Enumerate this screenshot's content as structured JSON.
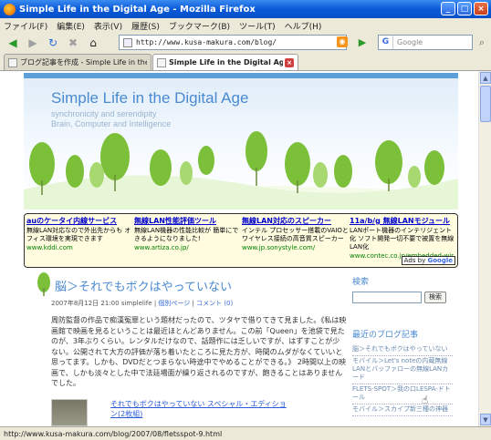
{
  "window": {
    "title": "Simple Life in the Digital Age - Mozilla Firefox"
  },
  "menu": [
    "ファイル(F)",
    "編集(E)",
    "表示(V)",
    "履歴(S)",
    "ブックマーク(B)",
    "ツール(T)",
    "ヘルプ(H)"
  ],
  "nav": {
    "url": "http://www.kusa-makura.com/blog/",
    "search_placeholder": "Google",
    "search_engine": "G"
  },
  "tabs": [
    {
      "label": "ブログ記事を作成 - Simple Life in the..."
    },
    {
      "label": "Simple Life in the Digital Age"
    }
  ],
  "header": {
    "title": "Simple Life in the Digital Age",
    "tagline": "synchronicity and serendipity",
    "sub": "Brain, Computer and Intelligence"
  },
  "ads": [
    {
      "title": "auのケータイ内線サービス",
      "desc": "無線LAN対応なので外出先からも オフィス環境を実現できます",
      "url": "www.kddi.com"
    },
    {
      "title": "無線LAN性能評価ツール",
      "desc": "無線LAN機器の性能比較が 簡単にできるようになりました!",
      "url": "www.artiza.co.jp/"
    },
    {
      "title": "無線LAN対応のスピーカー",
      "desc": "インテル プロセッサー搭載のVAIOとワイヤレス接続の高音質スピーカー",
      "url": "www.jp.sonystyle.com/"
    },
    {
      "title": "11a/b/g 無線LANモジュール",
      "desc": "LANポート機器のインテリジェント化 ソフト開発一切不要で被置を無線LAN化",
      "url": "www.contec.co.jp/embedded-wir"
    }
  ],
  "ads_by": "Ads by",
  "ads_brand": "Google",
  "post": {
    "title": "脳＞それでもボクはやっていない",
    "meta_date": "2007年8月12日 21:00",
    "meta_author": "simplelife",
    "meta_link1": "個別ページ",
    "meta_link2": "コメント (0)",
    "body": "周防監督の作品で痴漢冤罪という題材だったので、ツタヤで借りてきて見ました。《私は映画館で映画を見るということは最近ほとんどありません。この前「Queen」を池袋で見たのが、3年ぶりくらい。レンタルだけなので、話題作には乏しいですが、はずすことが少ない。公開されて大方の評価が落ち着いたところに見た方が、時間のムダがなくていいと思ってます。しかも、DVDだとつまらない時途中でやめることができる。》 2時間以上の映画で、しかも淡々とした中で法廷場面が繰り返されるのですが、飽きることはありませんでした。",
    "link": "それでもボクはやっていない スペシャル・エディション(2枚組)"
  },
  "sidebar": {
    "search_heading": "検索",
    "search_button": "検索",
    "recent_heading": "最近のブログ記事",
    "recent": [
      "脳＞それでもボクはやっていない",
      "モバイル＞Let's noteの内蔵無線LANとバッファローの無線LANカード",
      "FLETS-SPOT＞我の口LESPA-ドトール",
      "モバイル＞スカイプ新三種の神器"
    ]
  },
  "status": "http://www.kusa-makura.com/blog/2007/08/fletsspot-9.html"
}
